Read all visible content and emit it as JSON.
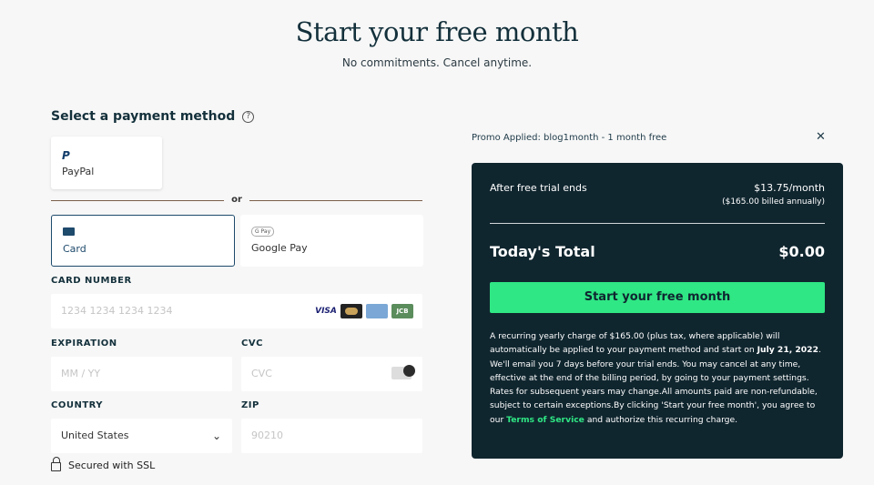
{
  "header": {
    "title": "Start your free month",
    "subtitle": "No commitments. Cancel anytime."
  },
  "payment": {
    "section_title": "Select a payment method",
    "help_icon": "question-circle-icon",
    "methods": {
      "paypal": "PayPal",
      "or": "or",
      "card": "Card",
      "gpay": "Google Pay",
      "gpay_badge": "G Pay",
      "paypal_glyph": "P"
    },
    "card_number_label": "CARD NUMBER",
    "card_number_placeholder": "1234 1234 1234 1234",
    "card_brands": [
      "VISA",
      "MC",
      "AMEX",
      "JCB"
    ],
    "expiration_label": "EXPIRATION",
    "expiration_placeholder": "MM / YY",
    "cvc_label": "CVC",
    "cvc_placeholder": "CVC",
    "country_label": "COUNTRY",
    "country_value": "United States",
    "zip_label": "ZIP",
    "zip_placeholder": "90210",
    "ssl_text": "Secured with SSL"
  },
  "promo": {
    "text": "Promo Applied: blog1month - 1 month free",
    "close_glyph": "✕"
  },
  "summary": {
    "after_label": "After free trial ends",
    "after_price": "$13.75/month",
    "after_billed": "($165.00 billed annually)",
    "total_label": "Today's Total",
    "total_value": "$0.00",
    "cta": "Start your free month",
    "legal_1": "A recurring yearly charge of $165.00 (plus tax, where applicable) will automatically be applied to your payment method and start on ",
    "legal_date": "July 21, 2022",
    "legal_2": ". We'll email you 7 days before your trial ends. You may cancel at any time, effective at the end of the billing period, by going to your payment settings. Rates for subsequent years may change.All amounts paid are non-refundable, subject to certain exceptions.By clicking 'Start your free month', you agree to our ",
    "legal_tos": "Terms of Service",
    "legal_3": " and authorize this recurring charge."
  },
  "colors": {
    "accent": "#2fe784",
    "panel": "#10262f",
    "selected_border": "#1e4a6c"
  }
}
